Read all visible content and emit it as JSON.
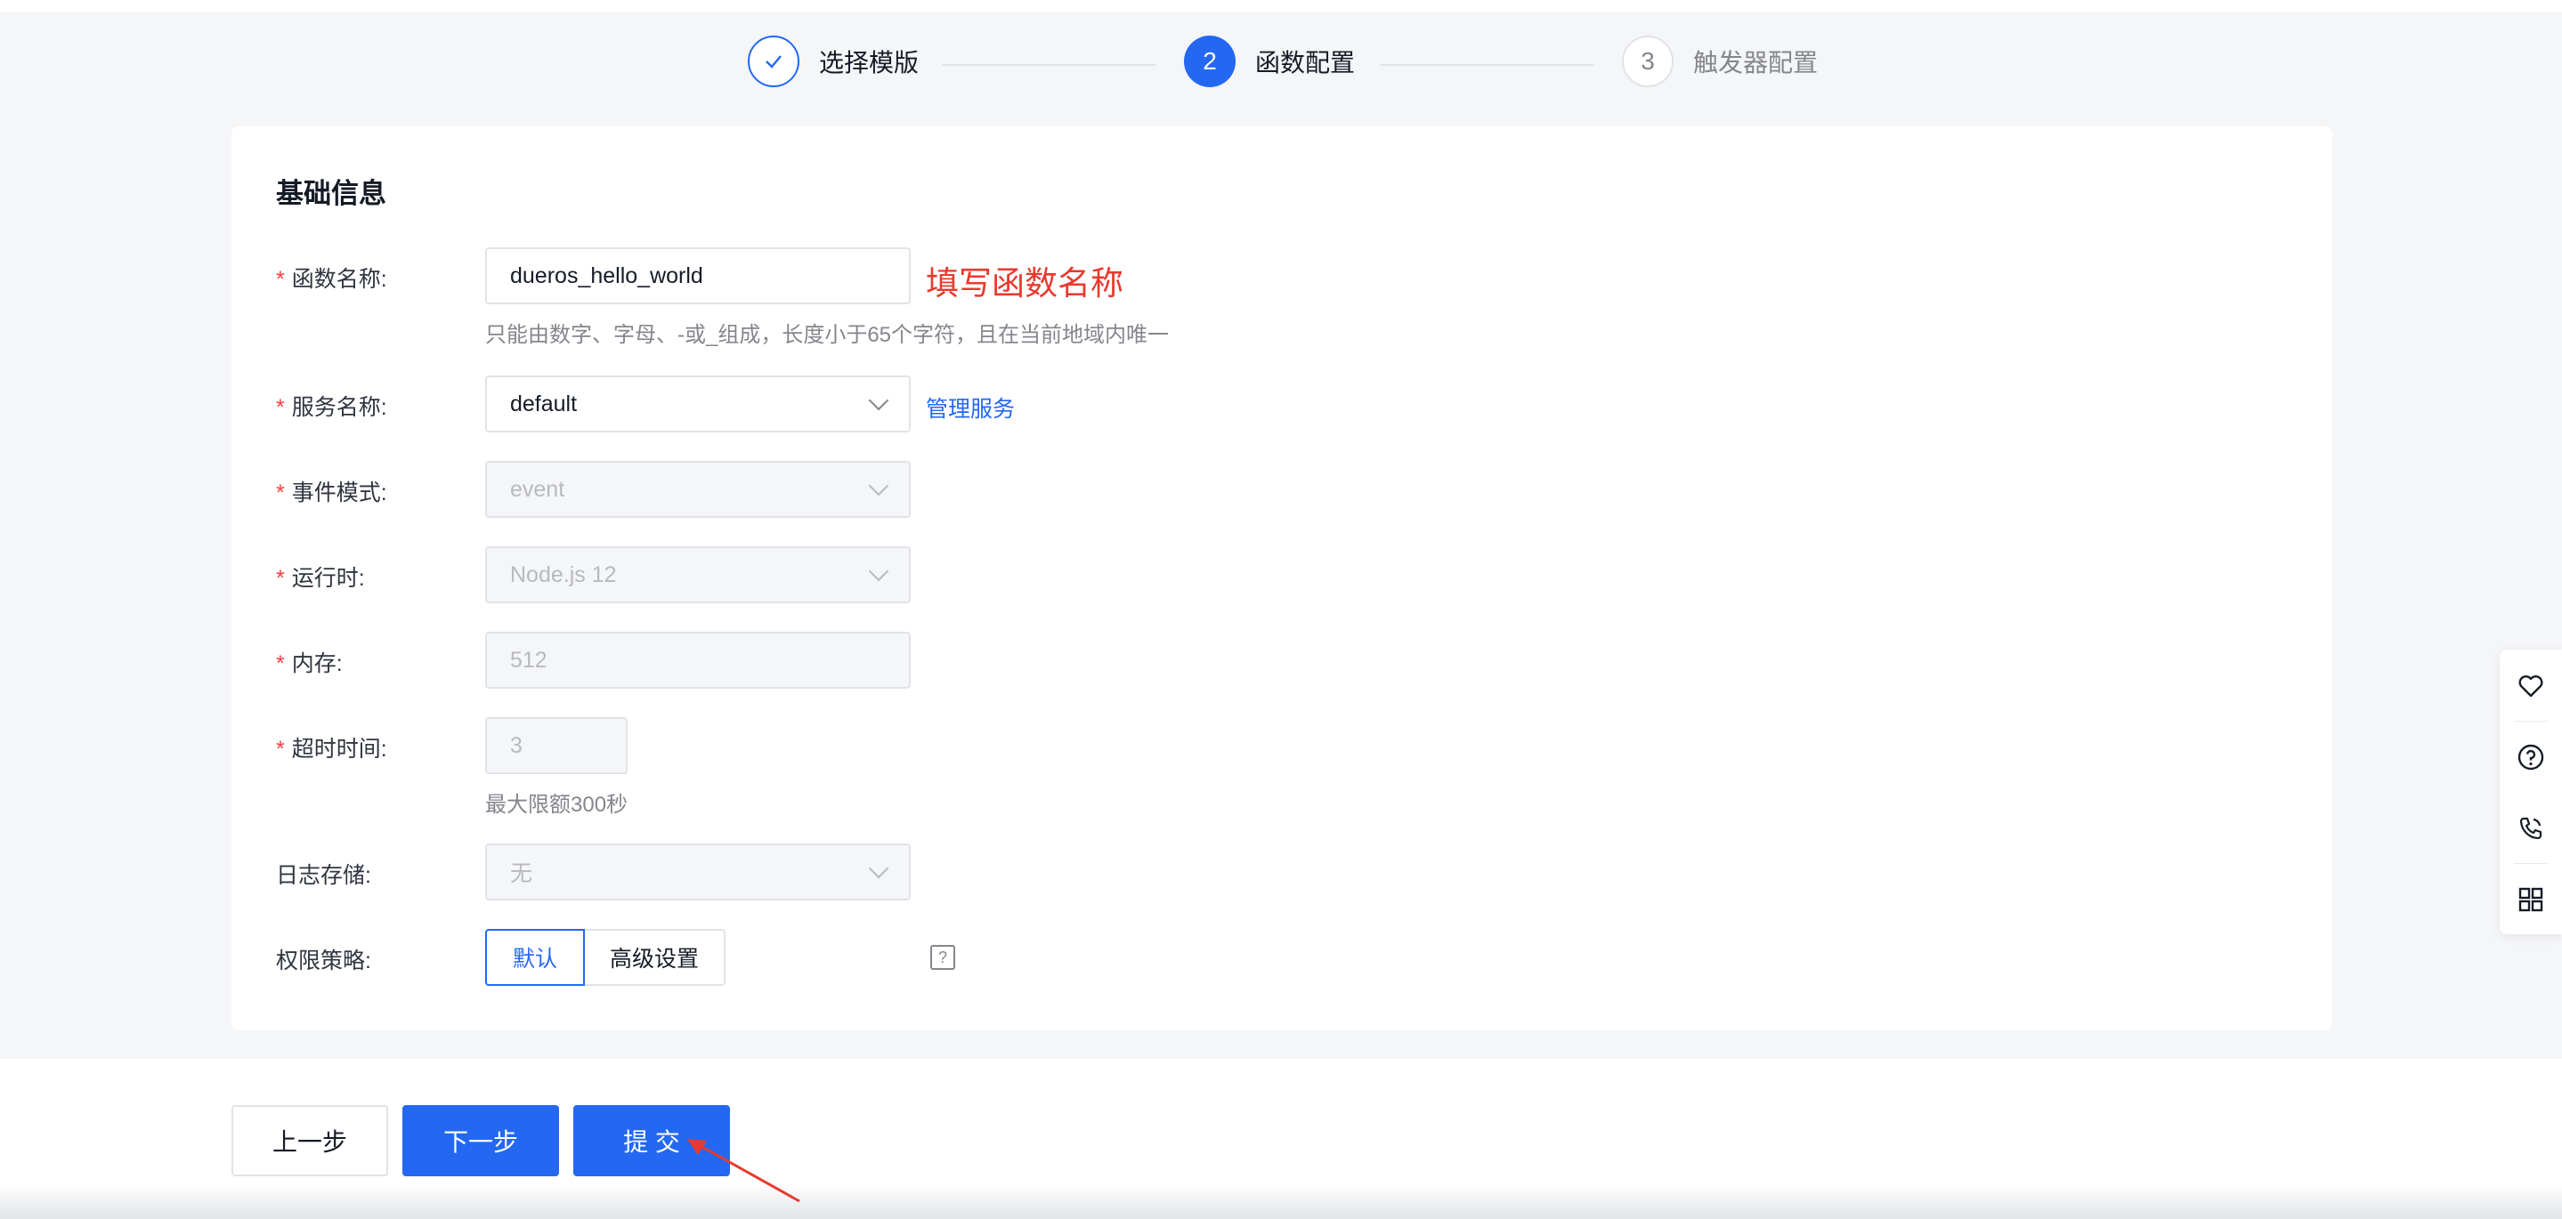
{
  "steps": [
    {
      "number": "✓",
      "label": "选择模版",
      "state": "done"
    },
    {
      "number": "2",
      "label": "函数配置",
      "state": "active"
    },
    {
      "number": "3",
      "label": "触发器配置",
      "state": "pending"
    }
  ],
  "section_title": "基础信息",
  "form": {
    "function_name": {
      "label": "函数名称:",
      "value": "dueros_hello_world",
      "hint": "只能由数字、字母、-或_组成，长度小于65个字符，且在当前地域内唯一",
      "annotation": "填写函数名称"
    },
    "service_name": {
      "label": "服务名称:",
      "value": "default",
      "link": "管理服务"
    },
    "event_mode": {
      "label": "事件模式:",
      "value": "event"
    },
    "runtime": {
      "label": "运行时:",
      "value": "Node.js 12"
    },
    "memory": {
      "label": "内存:",
      "value": "512"
    },
    "timeout": {
      "label": "超时时间:",
      "value": "3",
      "hint": "最大限额300秒"
    },
    "log_storage": {
      "label": "日志存储:",
      "value": "无"
    },
    "permission": {
      "label": "权限策略:",
      "options": [
        "默认",
        "高级设置"
      ],
      "selected": "默认",
      "help": "?"
    }
  },
  "required_mark": "*",
  "footer": {
    "prev": "上一步",
    "next": "下一步",
    "submit": "提 交"
  },
  "floatbar_icons": [
    "heart-icon",
    "help-circle-icon",
    "phone-icon",
    "grid-icon"
  ],
  "colors": {
    "primary": "#2468f2",
    "annotation": "#e83a2e",
    "required": "#f33e3e"
  }
}
